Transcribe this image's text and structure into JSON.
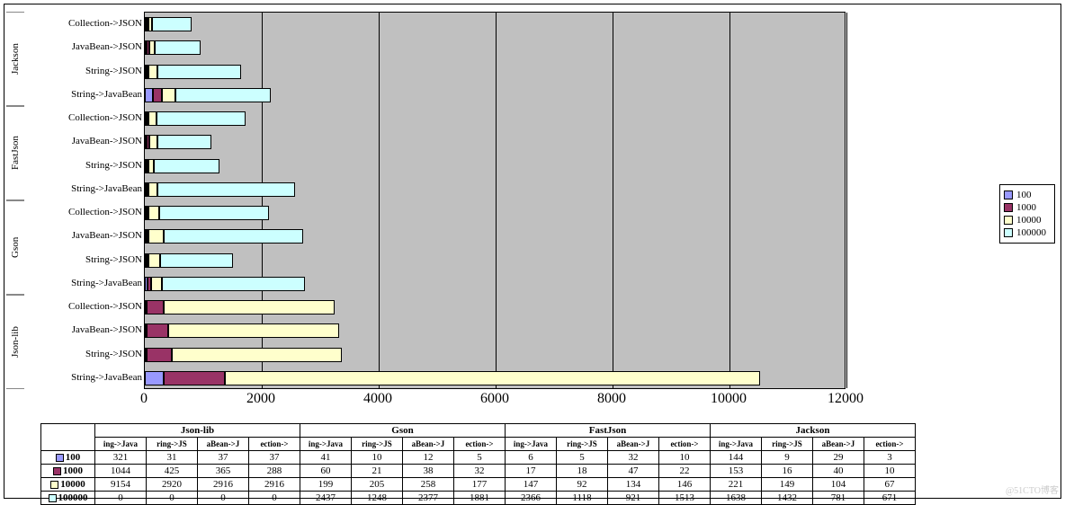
{
  "chart_data": {
    "type": "bar",
    "orientation": "horizontal-stacked",
    "x_axis": {
      "min": 0,
      "max": 12000,
      "ticks": [
        0,
        2000,
        4000,
        6000,
        8000,
        10000,
        12000
      ]
    },
    "series_legend": [
      "100",
      "1000",
      "10000",
      "100000"
    ],
    "libraries": [
      "Json-lib",
      "Gson",
      "FastJson",
      "Jackson"
    ],
    "operations": [
      "String->JavaBean",
      "String->JSON",
      "JavaBean->JSON",
      "Collection->JSON"
    ],
    "operations_short": [
      "ing->Java",
      "ring->JS",
      "aBean->J",
      "ection->"
    ],
    "data": {
      "Json-lib": {
        "String->JavaBean": {
          "100": 321,
          "1000": 1044,
          "10000": 9154,
          "100000": 0
        },
        "String->JSON": {
          "100": 31,
          "1000": 425,
          "10000": 2920,
          "100000": 0
        },
        "JavaBean->JSON": {
          "100": 37,
          "1000": 365,
          "10000": 2916,
          "100000": 0
        },
        "Collection->JSON": {
          "100": 37,
          "1000": 288,
          "10000": 2916,
          "100000": 0
        }
      },
      "Gson": {
        "String->JavaBean": {
          "100": 41,
          "1000": 60,
          "10000": 199,
          "100000": 2437
        },
        "String->JSON": {
          "100": 10,
          "1000": 21,
          "10000": 205,
          "100000": 1248
        },
        "JavaBean->JSON": {
          "100": 12,
          "1000": 38,
          "10000": 258,
          "100000": 2377
        },
        "Collection->JSON": {
          "100": 5,
          "1000": 32,
          "10000": 177,
          "100000": 1881
        }
      },
      "FastJson": {
        "String->JavaBean": {
          "100": 6,
          "1000": 17,
          "10000": 147,
          "100000": 2366
        },
        "String->JSON": {
          "100": 5,
          "1000": 18,
          "10000": 92,
          "100000": 1118
        },
        "JavaBean->JSON": {
          "100": 32,
          "1000": 47,
          "10000": 134,
          "100000": 921
        },
        "Collection->JSON": {
          "100": 10,
          "1000": 22,
          "10000": 146,
          "100000": 1513
        }
      },
      "Jackson": {
        "String->JavaBean": {
          "100": 144,
          "1000": 153,
          "10000": 221,
          "100000": 1638
        },
        "String->JSON": {
          "100": 9,
          "1000": 16,
          "10000": 149,
          "100000": 1432
        },
        "JavaBean->JSON": {
          "100": 29,
          "1000": 40,
          "10000": 104,
          "100000": 781
        },
        "Collection->JSON": {
          "100": 3,
          "1000": 10,
          "10000": 67,
          "100000": 671
        }
      }
    }
  },
  "watermark": "@51CTO博客"
}
